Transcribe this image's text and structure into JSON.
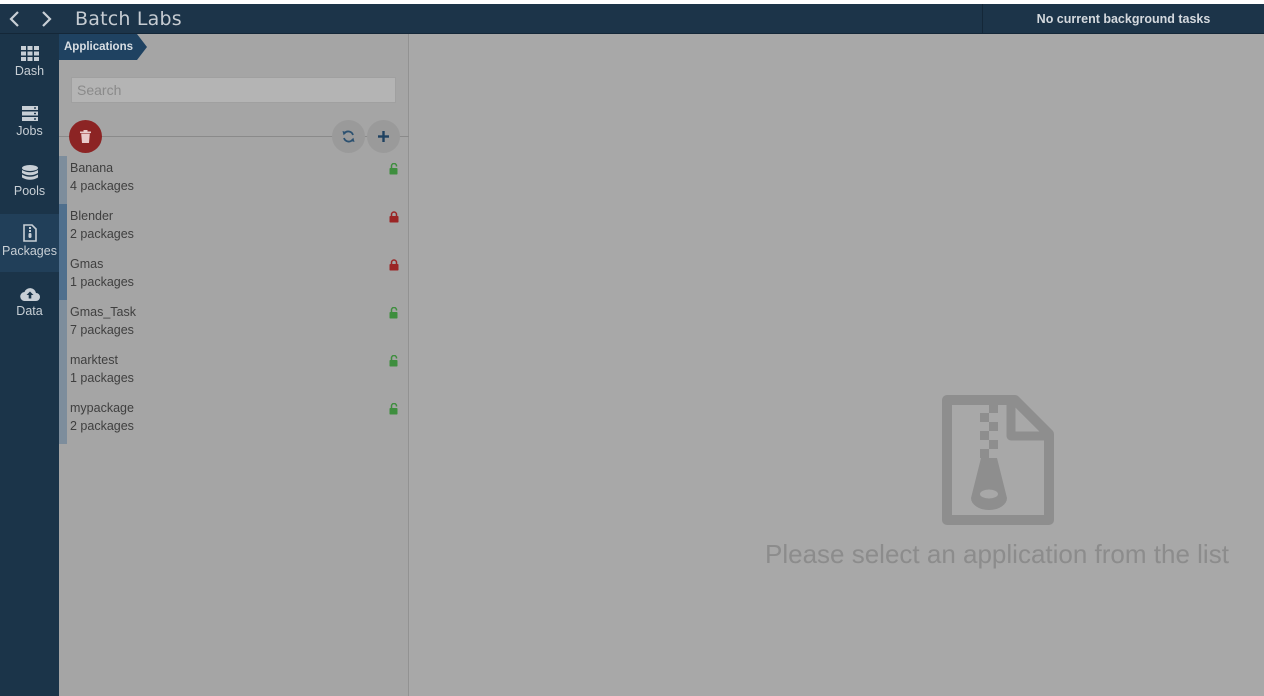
{
  "titlebar": {
    "back_icon": "chevron-left-icon",
    "forward_icon": "chevron-right-icon",
    "app_title": "Batch Labs",
    "background_tasks": "No current background tasks"
  },
  "leftnav": {
    "items": [
      {
        "label": "Dash",
        "icon": "grid-icon",
        "active": false
      },
      {
        "label": "Jobs",
        "icon": "server-icon",
        "active": false
      },
      {
        "label": "Pools",
        "icon": "database-icon",
        "active": false
      },
      {
        "label": "Packages",
        "icon": "file-archive-icon",
        "active": true
      },
      {
        "label": "Data",
        "icon": "cloud-upload-icon",
        "active": false
      }
    ]
  },
  "listpanel": {
    "breadcrumb": "Applications",
    "search_placeholder": "Search",
    "actions": {
      "delete_icon": "trash-icon",
      "refresh_icon": "refresh-icon",
      "add_icon": "plus-icon"
    },
    "applications": [
      {
        "name": "Banana",
        "packages": "4 packages",
        "lock": "unlocked"
      },
      {
        "name": "Blender",
        "packages": "2 packages",
        "lock": "locked"
      },
      {
        "name": "Gmas",
        "packages": "1 packages",
        "lock": "locked"
      },
      {
        "name": "Gmas_Task",
        "packages": "7 packages",
        "lock": "unlocked"
      },
      {
        "name": "marktest",
        "packages": "1 packages",
        "lock": "unlocked"
      },
      {
        "name": "mypackage",
        "packages": "2 packages",
        "lock": "unlocked"
      }
    ]
  },
  "detail": {
    "empty_icon": "file-zip-icon",
    "empty_message": "Please select an application from the list"
  },
  "colors": {
    "titlebar": "#1c3449",
    "nav_active": "#213f59",
    "delete_button": "#8c2424",
    "unlocked": "#3e8e3e",
    "locked": "#9b2525"
  }
}
